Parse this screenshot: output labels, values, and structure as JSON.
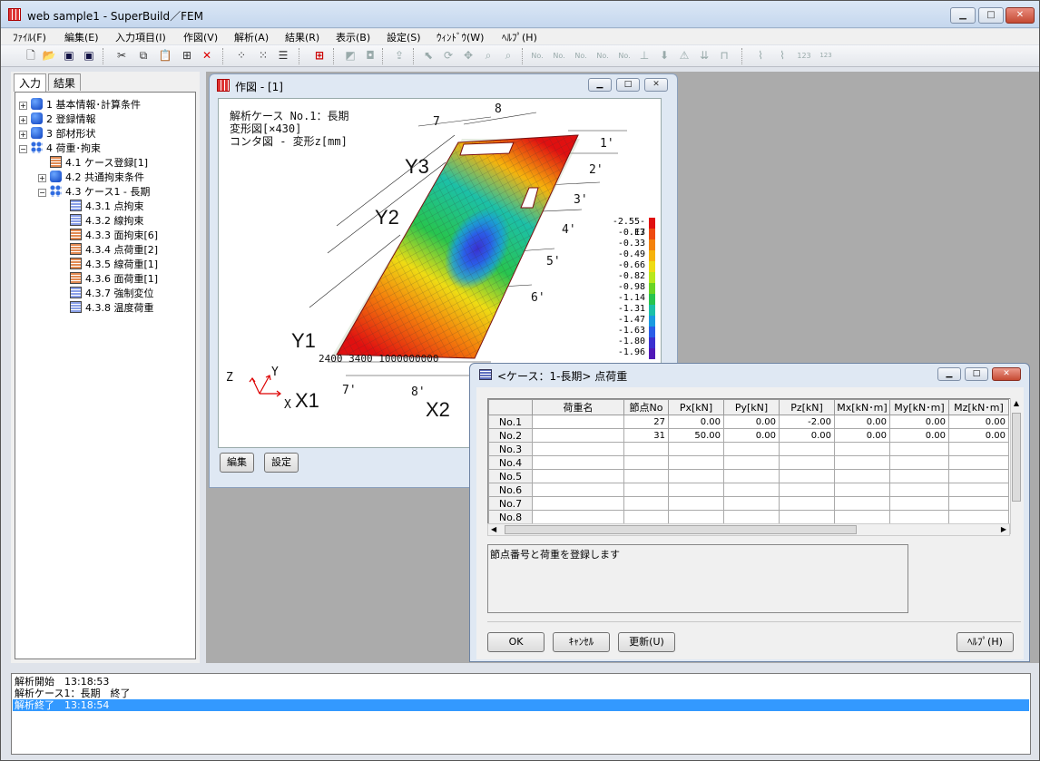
{
  "window": {
    "title": "web sample1 - SuperBuild／FEM"
  },
  "menu": [
    "ﾌｧｲﾙ(F)",
    "編集(E)",
    "入力項目(I)",
    "作図(V)",
    "解析(A)",
    "結果(R)",
    "表示(B)",
    "設定(S)",
    "ｳｨﾝﾄﾞｳ(W)",
    "ﾍﾙﾌﾟ(H)"
  ],
  "tabs": {
    "input": "入力",
    "result": "結果"
  },
  "tree": [
    {
      "label": "1 基本情報･計算条件",
      "level": 0,
      "icon": "cube-icon"
    },
    {
      "label": "2 登録情報",
      "level": 0,
      "icon": "cube-icon"
    },
    {
      "label": "3 部材形状",
      "level": 0,
      "icon": "cube-icon"
    },
    {
      "label": "4 荷重･拘束",
      "level": 0,
      "icon": "nodes-icon"
    },
    {
      "label": "4.1 ケース登録[1]",
      "level": 1,
      "icon": "table-icon"
    },
    {
      "label": "4.2 共通拘束条件",
      "level": 1,
      "icon": "cube-icon"
    },
    {
      "label": "4.3 ケース1 - 長期",
      "level": 1,
      "icon": "nodes-icon"
    },
    {
      "label": "4.3.1 点拘束",
      "level": 2,
      "icon": "table-icon"
    },
    {
      "label": "4.3.2 線拘束",
      "level": 2,
      "icon": "table-icon"
    },
    {
      "label": "4.3.3 面拘束[6]",
      "level": 2,
      "icon": "table-icon"
    },
    {
      "label": "4.3.4 点荷重[2]",
      "level": 2,
      "icon": "table-icon"
    },
    {
      "label": "4.3.5 線荷重[1]",
      "level": 2,
      "icon": "table-icon"
    },
    {
      "label": "4.3.6 面荷重[1]",
      "level": 2,
      "icon": "table-icon"
    },
    {
      "label": "4.3.7 強制変位",
      "level": 2,
      "icon": "table-icon"
    },
    {
      "label": "4.3.8 温度荷重",
      "level": 2,
      "icon": "table-icon"
    }
  ],
  "drawing_window": {
    "title": "作図 - [1]",
    "info_lines": [
      "解析ケース No.1：長期",
      "変形図[×430]",
      "コンタ図 - 変形z[mm]"
    ],
    "legend_values": [
      "-2.55-E3",
      "-0.17",
      "-0.33",
      "-0.49",
      "-0.66",
      "-0.82",
      "-0.98",
      "-1.14",
      "-1.31",
      "-1.47",
      "-1.63",
      "-1.80",
      "-1.96"
    ],
    "legend_colors": [
      "#e01010",
      "#ee4a10",
      "#f4820c",
      "#f6b30c",
      "#eedc14",
      "#b8e81c",
      "#6ad424",
      "#28c44e",
      "#1cc0a8",
      "#1a9ae0",
      "#2a5ee8",
      "#3a30d0",
      "#5018b8"
    ],
    "axis_labels": {
      "x1": "X1",
      "x2": "X2",
      "y1": "Y1",
      "y2": "Y2",
      "y3": "Y3"
    },
    "grid_marks": [
      "7",
      "8",
      "1'",
      "2'",
      "3'",
      "4'",
      "5'",
      "6'",
      "7'",
      "8'"
    ],
    "dims_bottom": "2400 3400 1000000000",
    "triad": {
      "x": "X",
      "y": "Y",
      "z": "Z"
    },
    "buttons": {
      "edit": "編集",
      "settings": "設定"
    }
  },
  "load_window": {
    "title": "<ケース：1-長期> 点荷重",
    "columns": [
      "",
      "荷重名",
      "節点No",
      "Px[kN]",
      "Py[kN]",
      "Pz[kN]",
      "Mx[kN･m]",
      "My[kN･m]",
      "Mz[kN･m]"
    ],
    "rows": [
      [
        "No.1",
        "",
        "27",
        "0.00",
        "0.00",
        "-2.00",
        "0.00",
        "0.00",
        "0.00"
      ],
      [
        "No.2",
        "",
        "31",
        "50.00",
        "0.00",
        "0.00",
        "0.00",
        "0.00",
        "0.00"
      ],
      [
        "No.3",
        "",
        "",
        "",
        "",
        "",
        "",
        "",
        ""
      ],
      [
        "No.4",
        "",
        "",
        "",
        "",
        "",
        "",
        "",
        ""
      ],
      [
        "No.5",
        "",
        "",
        "",
        "",
        "",
        "",
        "",
        ""
      ],
      [
        "No.6",
        "",
        "",
        "",
        "",
        "",
        "",
        "",
        ""
      ],
      [
        "No.7",
        "",
        "",
        "",
        "",
        "",
        "",
        "",
        ""
      ],
      [
        "No.8",
        "",
        "",
        "",
        "",
        "",
        "",
        "",
        ""
      ]
    ],
    "description": "節点番号と荷重を登録します",
    "buttons": {
      "ok": "OK",
      "cancel": "ｷｬﾝｾﾙ",
      "update": "更新(U)",
      "help": "ﾍﾙﾌﾟ(H)"
    }
  },
  "log": [
    "解析開始　13:18:53",
    "解析ケース1：長期　終了",
    "解析終了　13:18:54"
  ]
}
